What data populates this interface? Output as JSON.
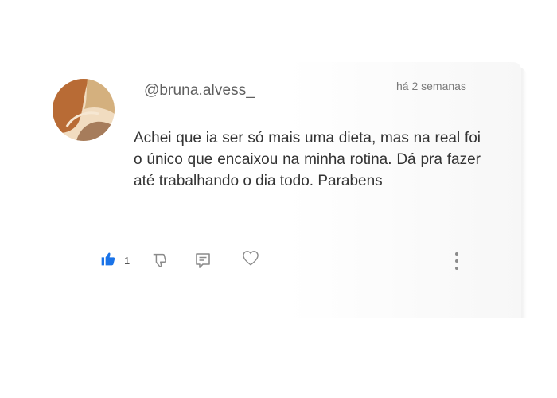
{
  "comment": {
    "username": "@bruna.alvess_",
    "timestamp": "há 2 semanas",
    "text": "Achei que ia ser só mais uma dieta, mas na real foi o único que encaixou na minha rotina. Dá pra fazer até trabalhando o dia todo. Parabens"
  },
  "actions": {
    "like_count": "1",
    "icons": [
      "thumbs-up-icon",
      "thumbs-down-icon",
      "reply-icon",
      "heart-icon",
      "more-options-icon"
    ]
  },
  "colors": {
    "like_active": "#1a73e8",
    "icon_gray": "#8a8a8a",
    "avatar": [
      "#b86b35",
      "#d4b07e",
      "#f1dcc0",
      "#a67c5b"
    ]
  }
}
